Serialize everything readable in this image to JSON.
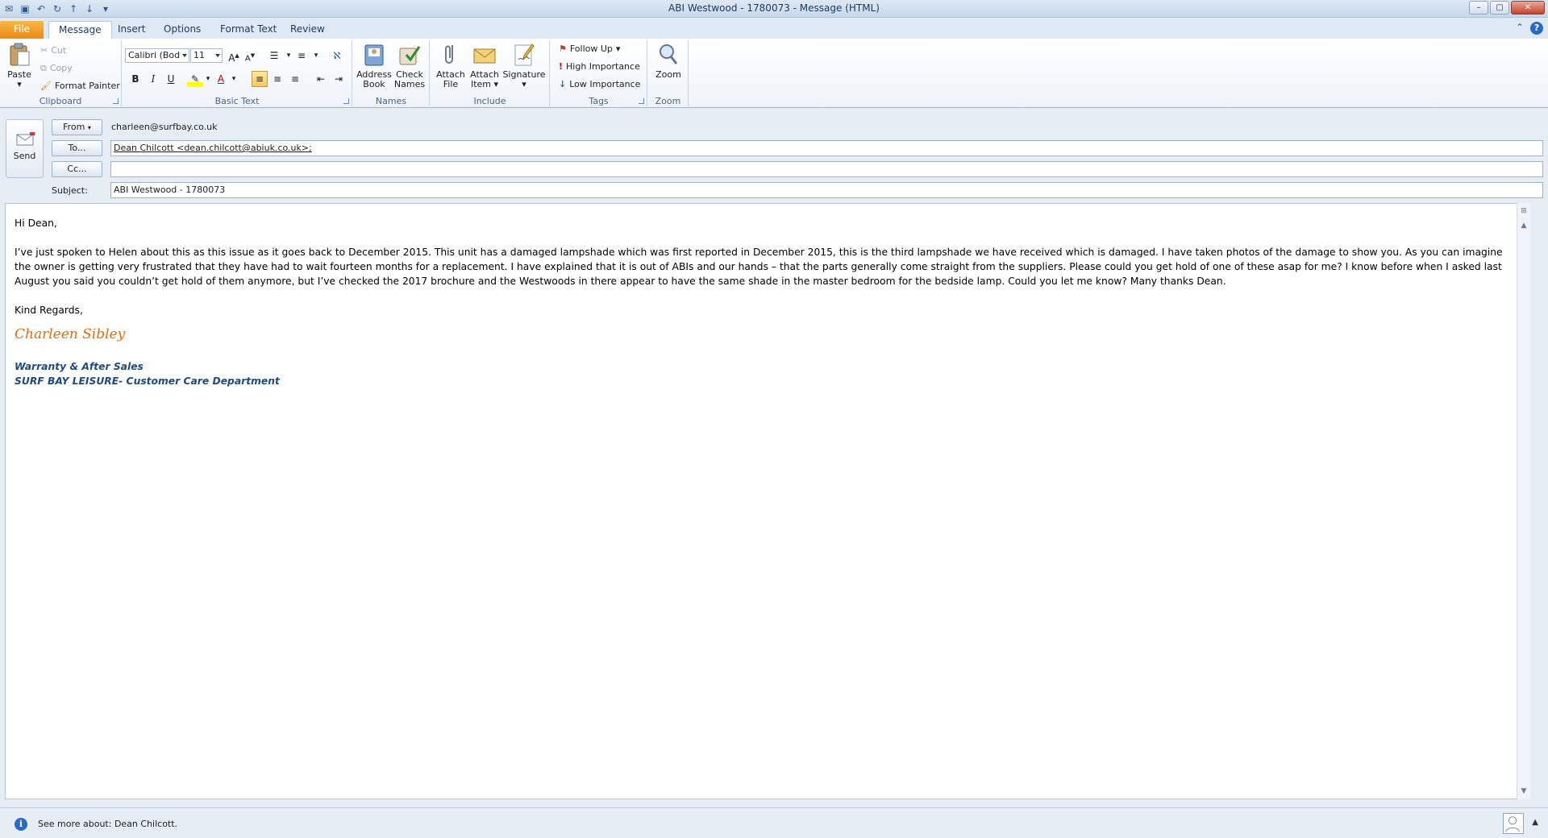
{
  "window": {
    "title": "ABI Westwood - 1780073  -  Message (HTML)"
  },
  "ribbon_tabs": [
    "File",
    "Message",
    "Insert",
    "Options",
    "Format Text",
    "Review"
  ],
  "ribbon": {
    "clipboard": {
      "label": "Clipboard",
      "paste": "Paste",
      "cut": "Cut",
      "copy": "Copy",
      "format_painter": "Format Painter"
    },
    "basic_text": {
      "label": "Basic Text",
      "font": "Calibri (Bod",
      "size": "11",
      "bold": "B",
      "italic": "I",
      "underline": "U"
    },
    "names": {
      "label": "Names",
      "address_book": [
        "Address",
        "Book"
      ],
      "check_names": [
        "Check",
        "Names"
      ]
    },
    "include": {
      "label": "Include",
      "attach_file": [
        "Attach",
        "File"
      ],
      "attach_item": [
        "Attach",
        "Item"
      ],
      "signature": "Signature"
    },
    "tags": {
      "label": "Tags",
      "follow_up": "Follow Up",
      "high_importance": "High Importance",
      "low_importance": "Low Importance"
    },
    "zoom": {
      "label": "Zoom",
      "zoom": "Zoom"
    }
  },
  "header": {
    "send": "Send",
    "from_label": "From",
    "from_value": "charleen@surfbay.co.uk",
    "to_label": "To...",
    "to_value": "Dean Chilcott <dean.chilcott@abiuk.co.uk>;",
    "cc_label": "Cc...",
    "cc_value": "",
    "subject_label": "Subject:",
    "subject_value": "ABI Westwood - 1780073"
  },
  "body": {
    "greeting": "Hi Dean,",
    "paragraph": "I’ve just spoken to Helen about this as this issue as it goes back to December 2015.  This unit has a damaged lampshade which was first reported in December 2015, this is the third lampshade we have received which is damaged.  I have taken photos of the damage to show you. As you can imagine the owner is getting very frustrated that they have had to wait fourteen months for a replacement.  I have explained that it is out of ABIs and our hands – that the parts generally come straight from the suppliers.  Please could you get hold of one of these asap for me?  I know before when I asked last August you said you couldn’t get hold of them anymore, but I’ve checked the 2017 brochure and the Westwoods in there appear to have the same shade in the master bedroom for the bedside lamp.  Could you let me know? Many thanks Dean.",
    "closing": "Kind Regards,",
    "signature_name": "Charleen Sibley",
    "signature_dept": "Warranty & After Sales",
    "signature_company": "SURF BAY LEISURE- Customer Care Department"
  },
  "status": {
    "text": "See more about: Dean Chilcott."
  },
  "colors": {
    "file_tab": "#ec8a11",
    "signature_name": "#e36c0a",
    "signature_dept": "#1f497d"
  }
}
